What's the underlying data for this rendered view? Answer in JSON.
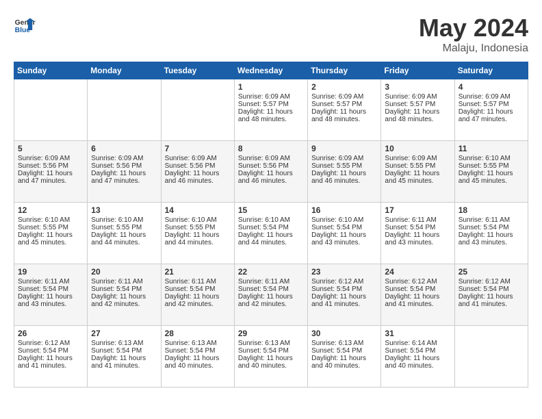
{
  "header": {
    "logo_general": "General",
    "logo_blue": "Blue",
    "month": "May 2024",
    "location": "Malaju, Indonesia"
  },
  "days_of_week": [
    "Sunday",
    "Monday",
    "Tuesday",
    "Wednesday",
    "Thursday",
    "Friday",
    "Saturday"
  ],
  "weeks": [
    [
      {
        "day": "",
        "info": ""
      },
      {
        "day": "",
        "info": ""
      },
      {
        "day": "",
        "info": ""
      },
      {
        "day": "1",
        "sunrise": "6:09 AM",
        "sunset": "5:57 PM",
        "daylight": "11 hours and 48 minutes."
      },
      {
        "day": "2",
        "sunrise": "6:09 AM",
        "sunset": "5:57 PM",
        "daylight": "11 hours and 48 minutes."
      },
      {
        "day": "3",
        "sunrise": "6:09 AM",
        "sunset": "5:57 PM",
        "daylight": "11 hours and 48 minutes."
      },
      {
        "day": "4",
        "sunrise": "6:09 AM",
        "sunset": "5:57 PM",
        "daylight": "11 hours and 47 minutes."
      }
    ],
    [
      {
        "day": "5",
        "sunrise": "6:09 AM",
        "sunset": "5:56 PM",
        "daylight": "11 hours and 47 minutes."
      },
      {
        "day": "6",
        "sunrise": "6:09 AM",
        "sunset": "5:56 PM",
        "daylight": "11 hours and 47 minutes."
      },
      {
        "day": "7",
        "sunrise": "6:09 AM",
        "sunset": "5:56 PM",
        "daylight": "11 hours and 46 minutes."
      },
      {
        "day": "8",
        "sunrise": "6:09 AM",
        "sunset": "5:56 PM",
        "daylight": "11 hours and 46 minutes."
      },
      {
        "day": "9",
        "sunrise": "6:09 AM",
        "sunset": "5:55 PM",
        "daylight": "11 hours and 46 minutes."
      },
      {
        "day": "10",
        "sunrise": "6:09 AM",
        "sunset": "5:55 PM",
        "daylight": "11 hours and 45 minutes."
      },
      {
        "day": "11",
        "sunrise": "6:10 AM",
        "sunset": "5:55 PM",
        "daylight": "11 hours and 45 minutes."
      }
    ],
    [
      {
        "day": "12",
        "sunrise": "6:10 AM",
        "sunset": "5:55 PM",
        "daylight": "11 hours and 45 minutes."
      },
      {
        "day": "13",
        "sunrise": "6:10 AM",
        "sunset": "5:55 PM",
        "daylight": "11 hours and 44 minutes."
      },
      {
        "day": "14",
        "sunrise": "6:10 AM",
        "sunset": "5:55 PM",
        "daylight": "11 hours and 44 minutes."
      },
      {
        "day": "15",
        "sunrise": "6:10 AM",
        "sunset": "5:54 PM",
        "daylight": "11 hours and 44 minutes."
      },
      {
        "day": "16",
        "sunrise": "6:10 AM",
        "sunset": "5:54 PM",
        "daylight": "11 hours and 43 minutes."
      },
      {
        "day": "17",
        "sunrise": "6:11 AM",
        "sunset": "5:54 PM",
        "daylight": "11 hours and 43 minutes."
      },
      {
        "day": "18",
        "sunrise": "6:11 AM",
        "sunset": "5:54 PM",
        "daylight": "11 hours and 43 minutes."
      }
    ],
    [
      {
        "day": "19",
        "sunrise": "6:11 AM",
        "sunset": "5:54 PM",
        "daylight": "11 hours and 43 minutes."
      },
      {
        "day": "20",
        "sunrise": "6:11 AM",
        "sunset": "5:54 PM",
        "daylight": "11 hours and 42 minutes."
      },
      {
        "day": "21",
        "sunrise": "6:11 AM",
        "sunset": "5:54 PM",
        "daylight": "11 hours and 42 minutes."
      },
      {
        "day": "22",
        "sunrise": "6:11 AM",
        "sunset": "5:54 PM",
        "daylight": "11 hours and 42 minutes."
      },
      {
        "day": "23",
        "sunrise": "6:12 AM",
        "sunset": "5:54 PM",
        "daylight": "11 hours and 41 minutes."
      },
      {
        "day": "24",
        "sunrise": "6:12 AM",
        "sunset": "5:54 PM",
        "daylight": "11 hours and 41 minutes."
      },
      {
        "day": "25",
        "sunrise": "6:12 AM",
        "sunset": "5:54 PM",
        "daylight": "11 hours and 41 minutes."
      }
    ],
    [
      {
        "day": "26",
        "sunrise": "6:12 AM",
        "sunset": "5:54 PM",
        "daylight": "11 hours and 41 minutes."
      },
      {
        "day": "27",
        "sunrise": "6:13 AM",
        "sunset": "5:54 PM",
        "daylight": "11 hours and 41 minutes."
      },
      {
        "day": "28",
        "sunrise": "6:13 AM",
        "sunset": "5:54 PM",
        "daylight": "11 hours and 40 minutes."
      },
      {
        "day": "29",
        "sunrise": "6:13 AM",
        "sunset": "5:54 PM",
        "daylight": "11 hours and 40 minutes."
      },
      {
        "day": "30",
        "sunrise": "6:13 AM",
        "sunset": "5:54 PM",
        "daylight": "11 hours and 40 minutes."
      },
      {
        "day": "31",
        "sunrise": "6:14 AM",
        "sunset": "5:54 PM",
        "daylight": "11 hours and 40 minutes."
      },
      {
        "day": "",
        "info": ""
      }
    ]
  ],
  "labels": {
    "sunrise_prefix": "Sunrise: ",
    "sunset_prefix": "Sunset: ",
    "daylight_label": "Daylight hours"
  }
}
